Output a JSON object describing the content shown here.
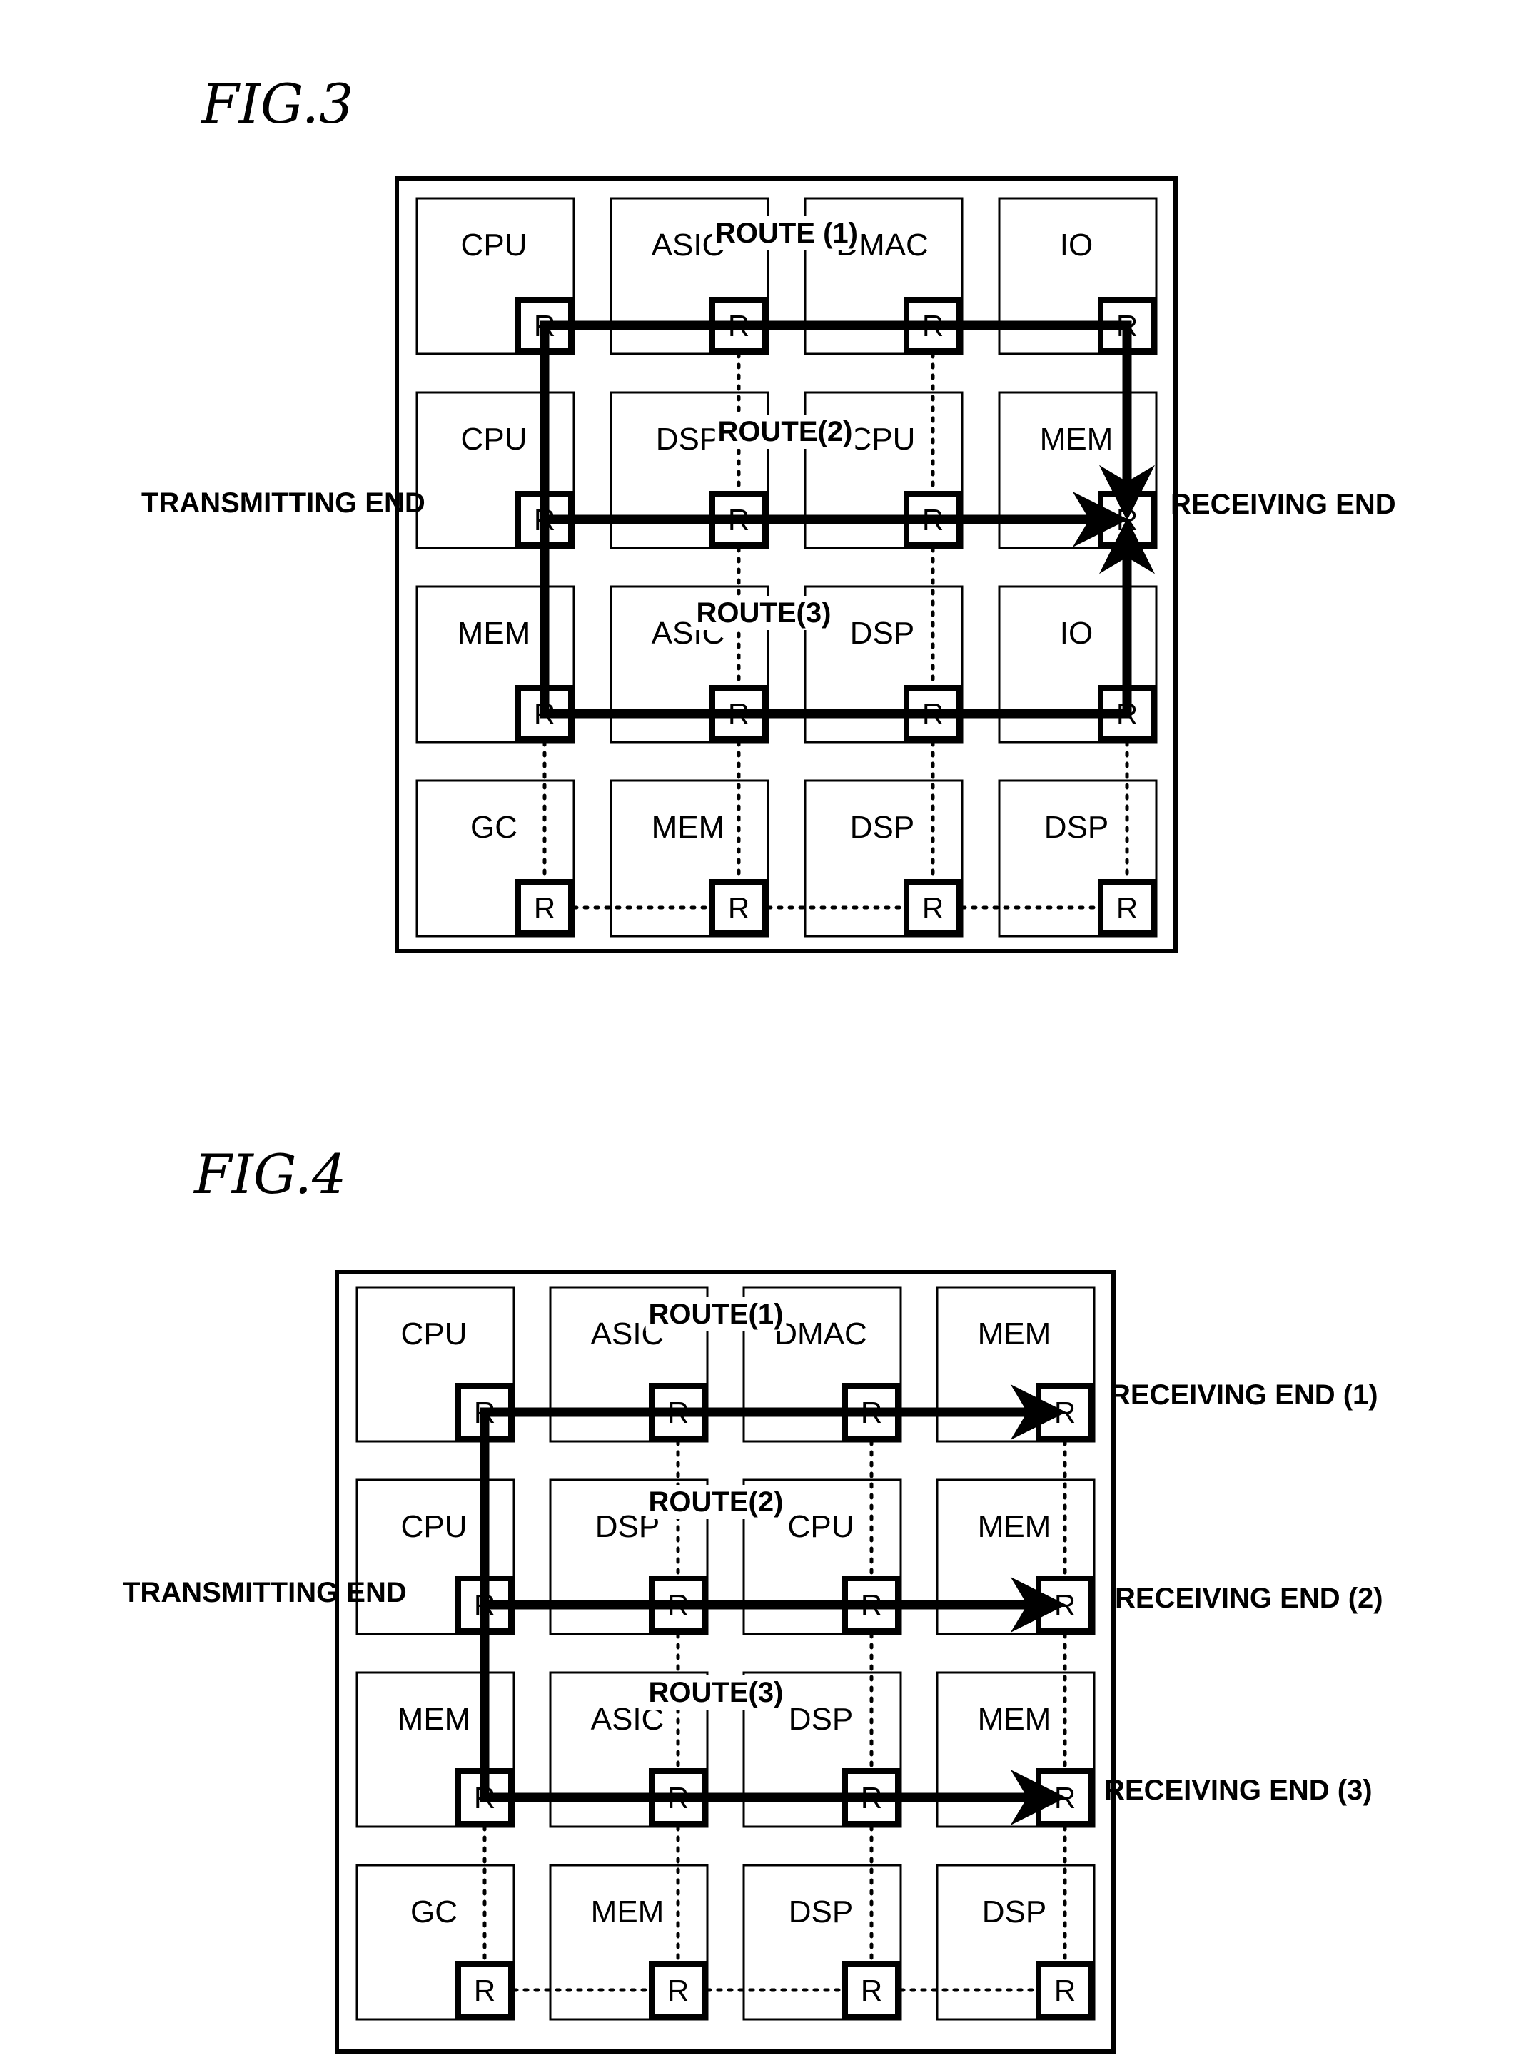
{
  "figures": [
    {
      "id": "fig3",
      "title": "FIG.3",
      "grid": [
        [
          "CPU",
          "ASIC",
          "DMAC",
          "IO"
        ],
        [
          "CPU",
          "DSP",
          "CPU",
          "MEM"
        ],
        [
          "MEM",
          "ASIC",
          "DSP",
          "IO"
        ],
        [
          "GC",
          "MEM",
          "DSP",
          "DSP"
        ]
      ],
      "router_label": "R",
      "transmitting_label": "TRANSMITTING END",
      "receiving_labels": [
        "RECEIVING END"
      ],
      "routes": [
        {
          "label": "ROUTE (1)",
          "path": [
            [
              1,
              0
            ],
            [
              0,
              0
            ],
            [
              0,
              3
            ],
            [
              1,
              3
            ]
          ]
        },
        {
          "label": "ROUTE(2)",
          "path": [
            [
              1,
              0
            ],
            [
              1,
              3
            ]
          ]
        },
        {
          "label": "ROUTE(3)",
          "path": [
            [
              1,
              0
            ],
            [
              2,
              0
            ],
            [
              2,
              3
            ],
            [
              1,
              3
            ]
          ]
        }
      ]
    },
    {
      "id": "fig4",
      "title": "FIG.4",
      "grid": [
        [
          "CPU",
          "ASIC",
          "DMAC",
          "MEM"
        ],
        [
          "CPU",
          "DSP",
          "CPU",
          "MEM"
        ],
        [
          "MEM",
          "ASIC",
          "DSP",
          "MEM"
        ],
        [
          "GC",
          "MEM",
          "DSP",
          "DSP"
        ]
      ],
      "router_label": "R",
      "transmitting_label": "TRANSMITTING END",
      "receiving_labels": [
        "RECEIVING END (1)",
        "RECEIVING END (2)",
        "RECEIVING END (3)"
      ],
      "routes": [
        {
          "label": "ROUTE(1)",
          "path": [
            [
              1,
              0
            ],
            [
              0,
              0
            ],
            [
              0,
              3
            ]
          ]
        },
        {
          "label": "ROUTE(2)",
          "path": [
            [
              1,
              0
            ],
            [
              1,
              3
            ]
          ]
        },
        {
          "label": "ROUTE(3)",
          "path": [
            [
              1,
              0
            ],
            [
              2,
              0
            ],
            [
              2,
              3
            ]
          ]
        }
      ]
    }
  ]
}
